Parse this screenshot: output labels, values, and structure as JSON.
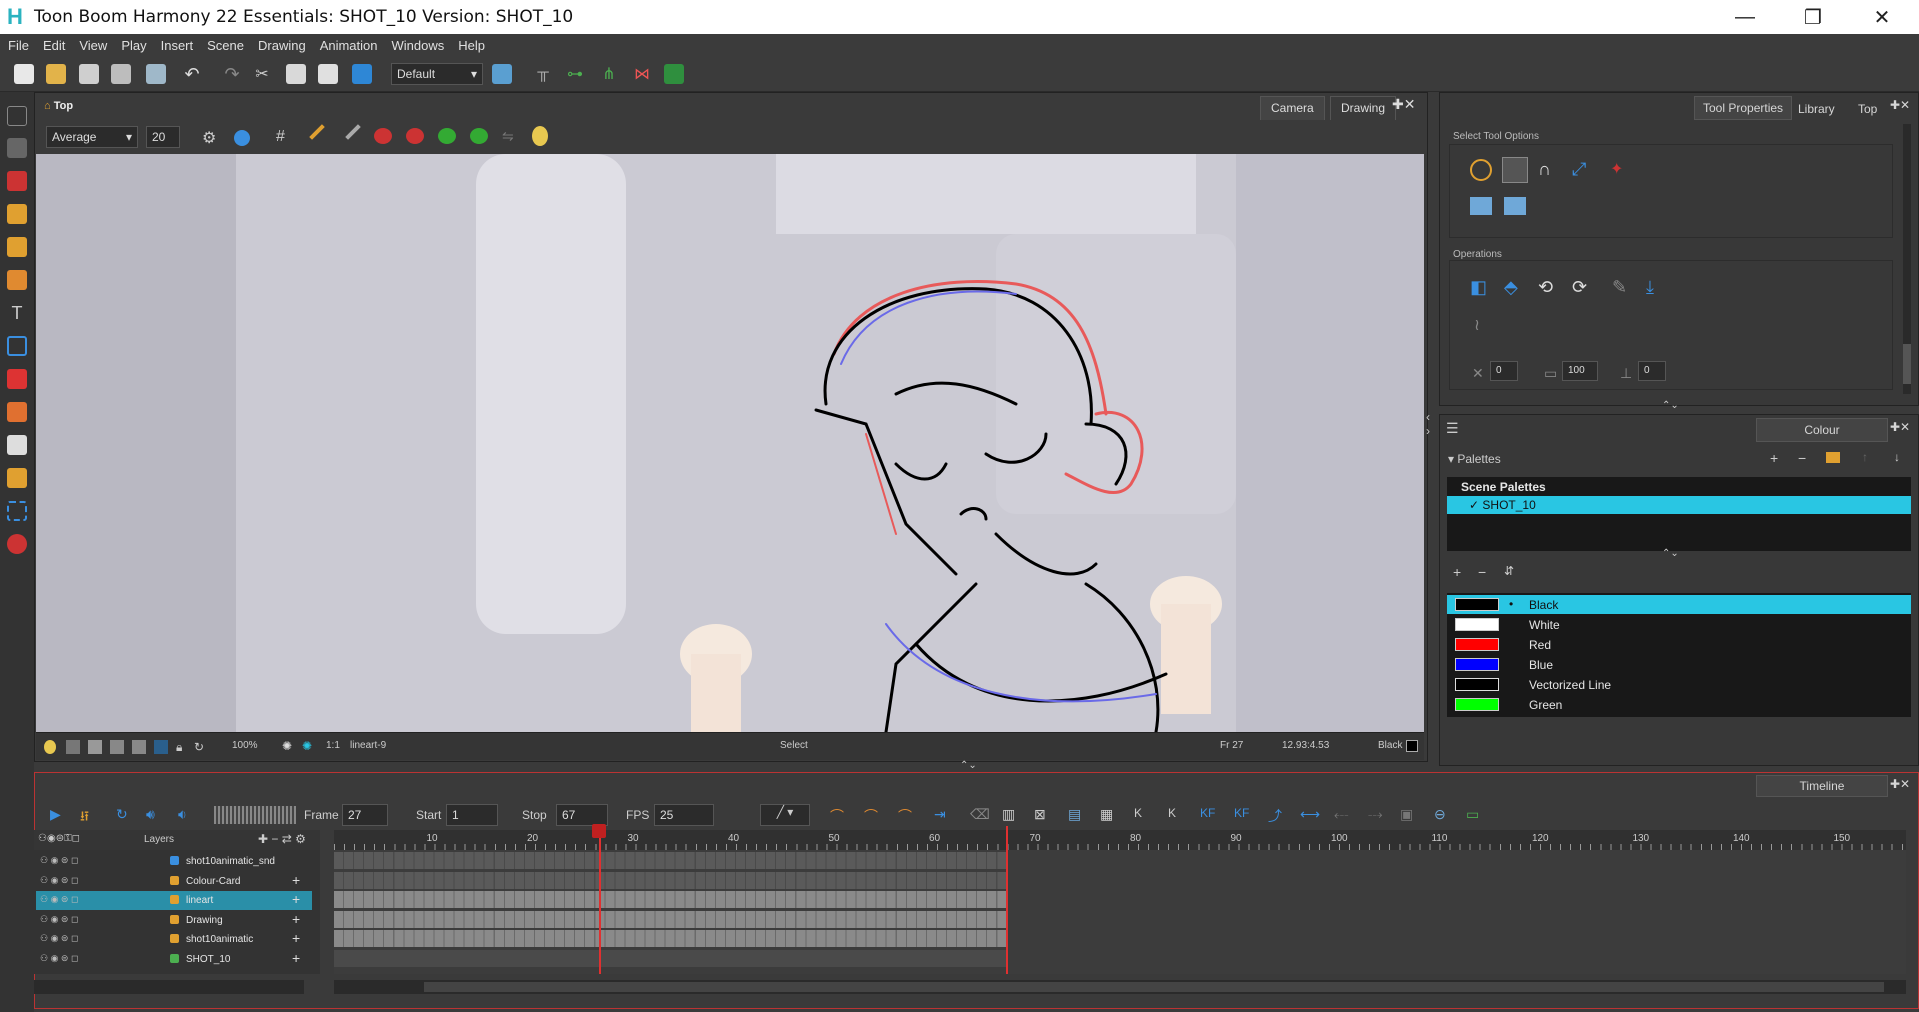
{
  "window": {
    "title": "Toon Boom Harmony 22 Essentials: SHOT_10 Version: SHOT_10",
    "minimize": "—",
    "restore": "❐",
    "close": "✕"
  },
  "menu": [
    "File",
    "Edit",
    "View",
    "Play",
    "Insert",
    "Scene",
    "Drawing",
    "Animation",
    "Windows",
    "Help"
  ],
  "toolbar": {
    "workspace": "Default"
  },
  "camera_view": {
    "tabs": [
      "Camera",
      "Drawing"
    ],
    "view_label": "Top",
    "smoothing": "Average",
    "size_value": "20",
    "status": {
      "zoom": "100%",
      "ratio": "1:1",
      "layer": "lineart-9",
      "tool": "Select",
      "frame": "Fr 27",
      "coords": "12.93:4.53",
      "colour": "Black"
    }
  },
  "tool_properties": {
    "tabs": [
      "Tool Properties",
      "Library",
      "Top"
    ],
    "section_select": "Select Tool Options",
    "section_operations": "Operations",
    "fields": [
      "0",
      "100",
      "0"
    ]
  },
  "colour_panel": {
    "tab": "Colour",
    "palettes_label": "Palettes",
    "scene_palettes_label": "Scene Palettes",
    "palette": "SHOT_10",
    "colours": [
      {
        "name": "Black",
        "hex": "#000000",
        "selected": true
      },
      {
        "name": "White",
        "hex": "#ffffff",
        "selected": false
      },
      {
        "name": "Red",
        "hex": "#ff0000",
        "selected": false
      },
      {
        "name": "Blue",
        "hex": "#0000ff",
        "selected": false
      },
      {
        "name": "Vectorized Line",
        "hex": "#000000",
        "selected": false
      },
      {
        "name": "Green",
        "hex": "#00ff00",
        "selected": false
      }
    ]
  },
  "timeline": {
    "tab": "Timeline",
    "frame_label": "Frame",
    "frame": "27",
    "start_label": "Start",
    "start": "1",
    "stop_label": "Stop",
    "stop": "67",
    "fps_label": "FPS",
    "fps": "25",
    "layers_header": "Layers",
    "ruler": [
      "10",
      "20",
      "30",
      "40",
      "50",
      "60",
      "70",
      "80",
      "90",
      "100",
      "110",
      "120",
      "130",
      "140",
      "150"
    ],
    "layers": [
      {
        "name": "shot10animatic_snd",
        "selected": false
      },
      {
        "name": "Colour-Card",
        "selected": false
      },
      {
        "name": "lineart",
        "selected": true
      },
      {
        "name": "Drawing",
        "selected": false
      },
      {
        "name": "shot10animatic",
        "selected": false
      },
      {
        "name": "SHOT_10",
        "selected": false
      }
    ]
  },
  "colors": {
    "accent": "#29c6e3",
    "panel": "#383838",
    "timeline_border": "#b33333"
  }
}
